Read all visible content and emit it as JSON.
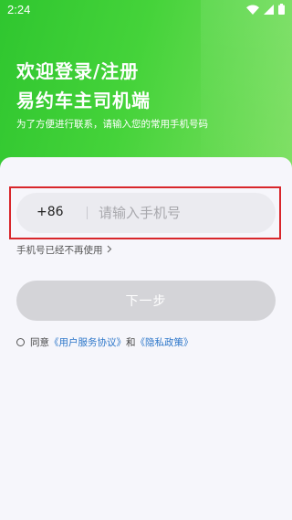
{
  "status_bar": {
    "time": "2:24"
  },
  "header": {
    "title_line1": "欢迎登录/注册",
    "title_line2": "易约车主司机端",
    "subtitle": "为了方便进行联系，请输入您的常用手机号码"
  },
  "form": {
    "country_code": "+86",
    "phone_placeholder": "请输入手机号",
    "phone_value": "",
    "phone_unavailable_label": "手机号已经不再使用",
    "next_button_label": "下一步"
  },
  "agreement": {
    "prefix": "同意",
    "user_agreement": "《用户服务协议》",
    "conjunction": "和",
    "privacy_policy": "《隐私政策》",
    "checked": false
  },
  "colors": {
    "header_green": "#3ccc34",
    "link_blue": "#2c76c9",
    "disabled_button": "#d4d4d8",
    "highlight_red": "#d8262b"
  },
  "icons": {
    "status": [
      "wifi-icon",
      "cellular-signal-icon",
      "battery-icon"
    ],
    "phone_unavailable": "chevron-right-icon"
  }
}
